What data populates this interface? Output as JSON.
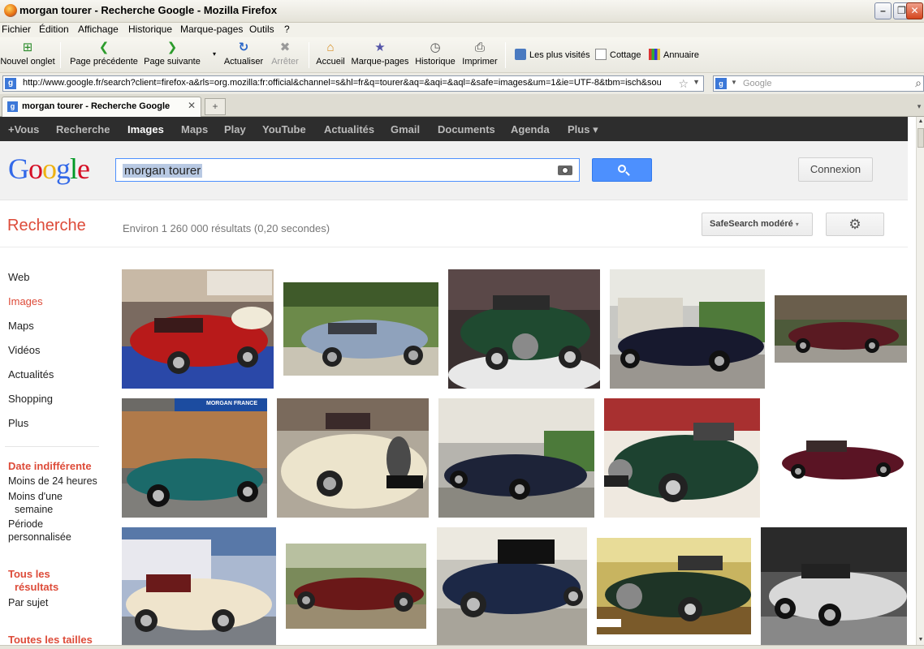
{
  "window": {
    "title": "morgan tourer - Recherche Google - Mozilla Firefox"
  },
  "menu": [
    "Fichier",
    "Édition",
    "Affichage",
    "Historique",
    "Marque-pages",
    "Outils",
    "?"
  ],
  "toolbar": {
    "new_tab": "Nouvel onglet",
    "back": "Page précédente",
    "forward": "Page suivante",
    "reload": "Actualiser",
    "stop": "Arrêter",
    "home": "Accueil",
    "bookmarks": "Marque-pages",
    "history": "Historique",
    "print": "Imprimer"
  },
  "bookmarks_bar": [
    "Les plus visités",
    "Cottage",
    "Annuaire"
  ],
  "urlbar": {
    "url": "http://www.google.fr/search?client=firefox-a&rls=org.mozilla:fr:official&channel=s&hl=fr&q=tourer&aq=&aqi=&aql=&safe=images&um=1&ie=UTF-8&tbm=isch&sou"
  },
  "search_engine": {
    "placeholder": "Google"
  },
  "tab": {
    "title": "morgan tourer - Recherche Google"
  },
  "gbar": [
    "+Vous",
    "Recherche",
    "Images",
    "Maps",
    "Play",
    "YouTube",
    "Actualités",
    "Gmail",
    "Documents",
    "Agenda",
    "Plus ▾"
  ],
  "google": {
    "logo": [
      "G",
      "o",
      "o",
      "g",
      "l",
      "e"
    ],
    "query": "morgan tourer",
    "signin": "Connexion",
    "section": "Recherche",
    "stats": "Environ 1 260 000 résultats (0,20 secondes)",
    "safesearch": "SafeSearch modéré",
    "safesearch_caret": "▾",
    "gear": "⚙"
  },
  "leftnav": {
    "items": [
      "Web",
      "Images",
      "Maps",
      "Vidéos",
      "Actualités",
      "Shopping",
      "Plus"
    ],
    "date_header": "Date indifférente",
    "date_opts": [
      "Moins de 24 heures",
      "Moins d'une",
      "semaine",
      "Période",
      "personnalisée"
    ],
    "results_header_1": "Tous les",
    "results_header_2": "résultats",
    "results_opt": "Par sujet",
    "size_header": "Toutes les tailles"
  },
  "image_signs": {
    "banner": "MORGAN FRANCE"
  },
  "colors": {
    "accent_red": "#dd4b39",
    "search_blue": "#4d90fe",
    "gbar_bg": "#2d2d2d"
  }
}
